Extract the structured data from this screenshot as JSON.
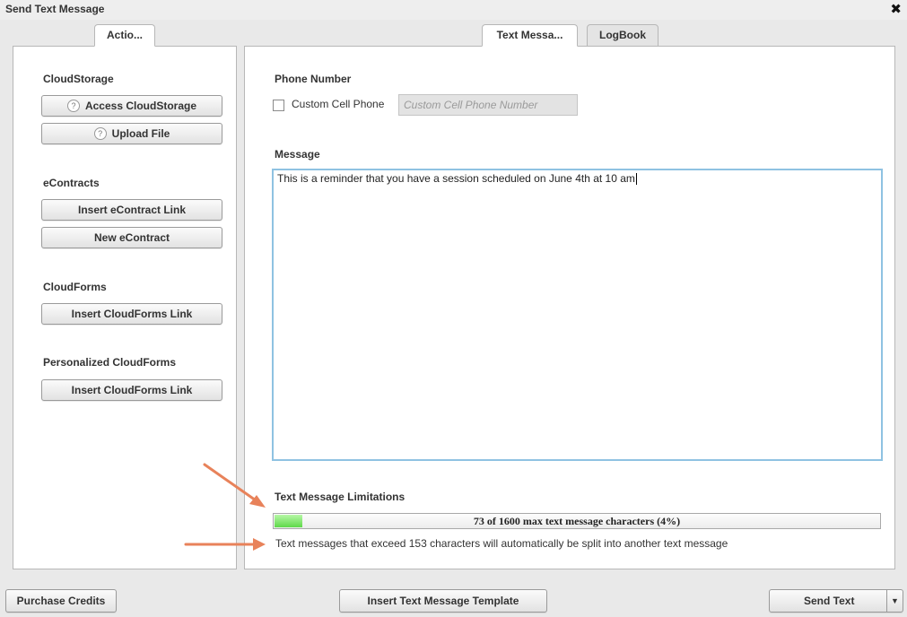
{
  "window": {
    "title": "Send Text Message",
    "close_icon": "✖"
  },
  "tabs": {
    "actions": "Actio...",
    "text_message": "Text Messa...",
    "logbook": "LogBook"
  },
  "sidebar": {
    "cloudstorage_title": "CloudStorage",
    "access_cloudstorage": "Access CloudStorage",
    "upload_file": "Upload File",
    "econtracts_title": "eContracts",
    "insert_econtract_link": "Insert eContract Link",
    "new_econtract": "New eContract",
    "cloudforms_title": "CloudForms",
    "insert_cloudforms_link": "Insert CloudForms Link",
    "personalized_title": "Personalized CloudForms",
    "insert_personalized_cloudforms_link": "Insert CloudForms Link",
    "help_icon": "?"
  },
  "phone": {
    "title": "Phone Number",
    "custom_cell_label": "Custom Cell Phone",
    "custom_cell_checked": false,
    "custom_cell_value": "",
    "custom_cell_placeholder": "Custom Cell Phone Number"
  },
  "message": {
    "title": "Message",
    "value": "This is a reminder that you have a session scheduled on June 4th at 10 am"
  },
  "limitations": {
    "title": "Text Message Limitations",
    "progress_text": "73 of 1600 max text message characters (4%)",
    "progress_fraction": 0.046,
    "note": "Text messages that exceed 153 characters will automatically be split into another text message"
  },
  "footer": {
    "purchase_credits": "Purchase Credits",
    "insert_template": "Insert Text Message Template",
    "send_text": "Send Text",
    "dropdown_caret": "▼"
  },
  "colors": {
    "progress_fill": "#5fd94a",
    "message_border": "#8fc2e2",
    "annotation_arrow": "#e8825a"
  }
}
